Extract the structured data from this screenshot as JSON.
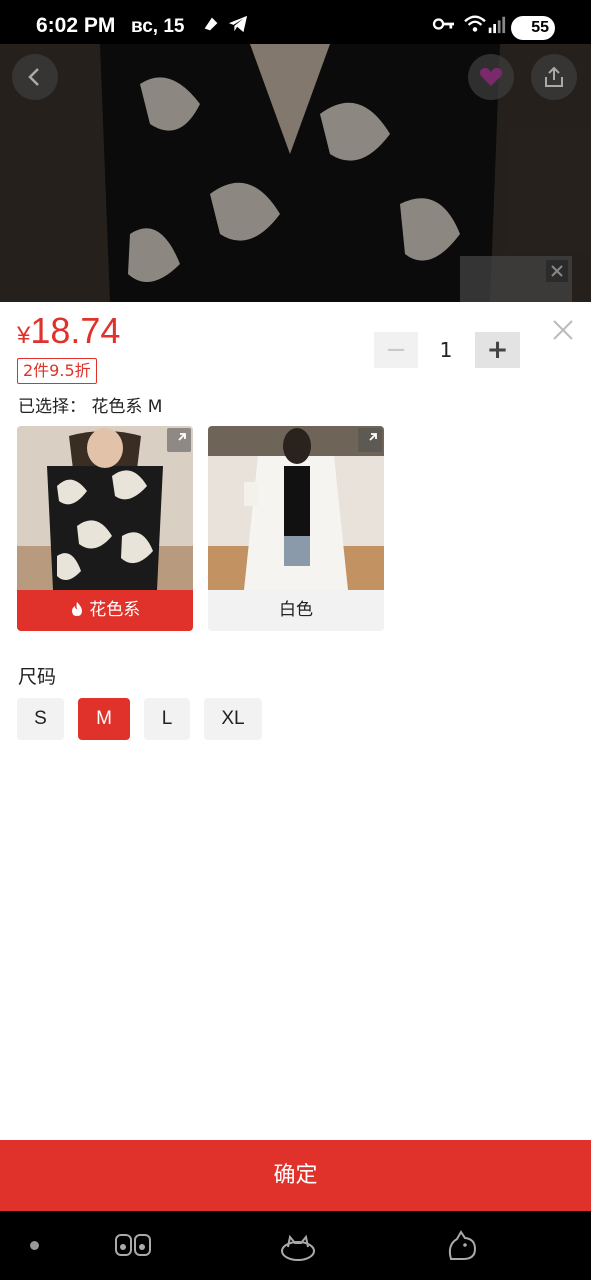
{
  "status_bar": {
    "time": "6:02 PM",
    "date": "вс, 15",
    "battery": "55"
  },
  "product": {
    "currency": "¥",
    "price": "18.74",
    "discount_tag": "2件9.5折",
    "selected_label": "已选择：",
    "selected_value": "花色系 M",
    "quantity": "1"
  },
  "stepper": {
    "minus": "−",
    "plus": "+"
  },
  "colors": {
    "accent": "#e0312a",
    "options": [
      {
        "label": "花色系",
        "selected": true,
        "hot": true
      },
      {
        "label": "白色",
        "selected": false,
        "hot": false
      }
    ]
  },
  "size": {
    "title": "尺码",
    "options": [
      "S",
      "M",
      "L",
      "XL"
    ],
    "selected": "M"
  },
  "confirm_label": "确定",
  "icons": {
    "back": "chevron-left-icon",
    "share": "share-icon",
    "close": "close-icon",
    "expand": "expand-icon",
    "hot": "flame-icon"
  }
}
